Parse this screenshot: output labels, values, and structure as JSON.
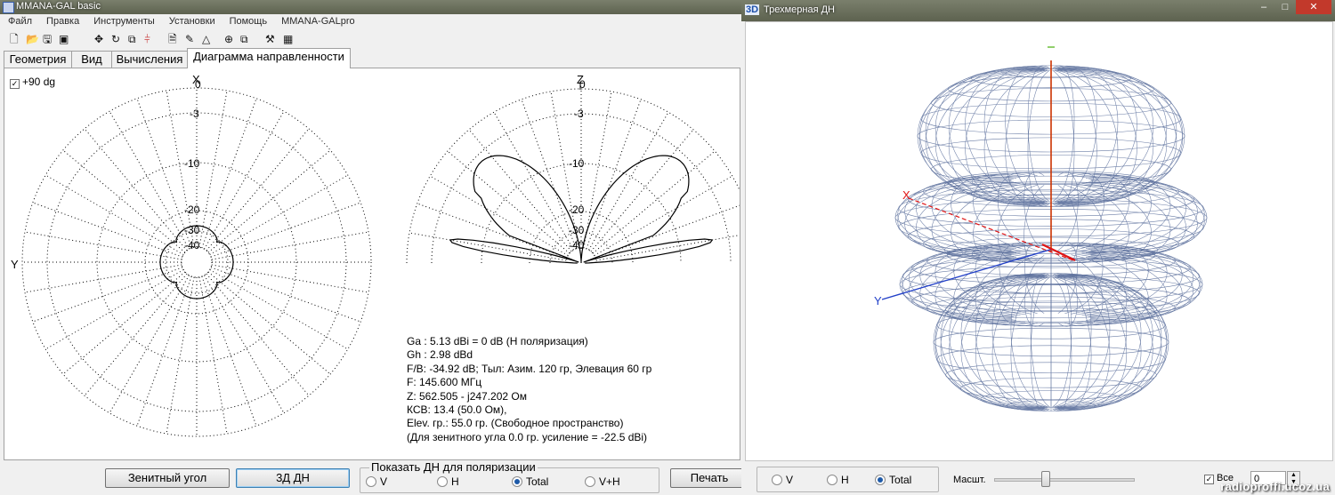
{
  "win2d": {
    "title": "MMANA-GAL basic",
    "menu": [
      "Файл",
      "Правка",
      "Инструменты",
      "Установки",
      "Помощь",
      "MMANA-GALpro"
    ],
    "tabs": [
      "Геометрия",
      "Вид",
      "Вычисления",
      "Диаграмма направленности"
    ],
    "active_tab": 3,
    "plus90_label": "+90 dg",
    "plus90_checked": true,
    "azimuth_plot": {
      "x_axis_label": "X",
      "y_axis_label": "Y",
      "rings": [
        "0",
        "-3",
        "-10",
        "-20",
        "-30",
        "-40"
      ]
    },
    "elevation_plot": {
      "z_axis_label": "Z",
      "rings": [
        "0",
        "-3",
        "-10",
        "-20",
        "-30",
        "-40"
      ]
    },
    "info_lines": [
      "Ga : 5.13 dBi = 0 dB  (H поляризация)",
      "Gh : 2.98 dBd",
      "F/B: -34.92 dB; Тыл: Азим. 120 гр, Элевация 60 гр",
      "F: 145.600 МГц",
      "Z: 562.505 - j247.202 Ом",
      "КСВ: 13.4 (50.0 Ом),",
      "Elev. гр.: 55.0 гр. (Свободное пространство)",
      "(Для зенитного угла 0.0 гр. усиление = -22.5 dBi)"
    ],
    "buttons": {
      "zenith": "Зенитный угол",
      "view3d": "3Д  ДН",
      "print": "Печать"
    },
    "polarization_group": {
      "label": "Показать ДН для поляризации",
      "options": [
        {
          "label": "V",
          "selected": false
        },
        {
          "label": "H",
          "selected": false
        },
        {
          "label": "Total",
          "selected": true
        },
        {
          "label": "V+H",
          "selected": false
        }
      ]
    }
  },
  "win3d": {
    "badge": "3D",
    "title": "Трехмерная ДН",
    "axis_x_label": "X",
    "axis_y_label": "Y",
    "options": [
      {
        "label": "V",
        "selected": false
      },
      {
        "label": "H",
        "selected": false
      },
      {
        "label": "Total",
        "selected": true
      }
    ],
    "scale_label": "Масшт.",
    "scale_value": 0.35,
    "all_label": "Все",
    "all_checked": true,
    "spin_value": "0"
  },
  "watermark": "radioproffi.ucoz.ua",
  "colors": {
    "wire": "#5b6f9c",
    "axis_x": "#e01515",
    "axis_y": "#2240c8",
    "axis_z": "#cc3300",
    "radio_dot": "#1e5aa8"
  },
  "icons": [
    "new-file-icon",
    "open-folder-icon",
    "save-disk-icon",
    "save-as-icon",
    "move-arrows-icon",
    "rotate-icon",
    "add-wire-icon",
    "segments-icon",
    "document-icon",
    "edit-icon",
    "triangle-icon",
    "target-icon",
    "copy-icon",
    "tools-icon",
    "calculator-icon"
  ]
}
